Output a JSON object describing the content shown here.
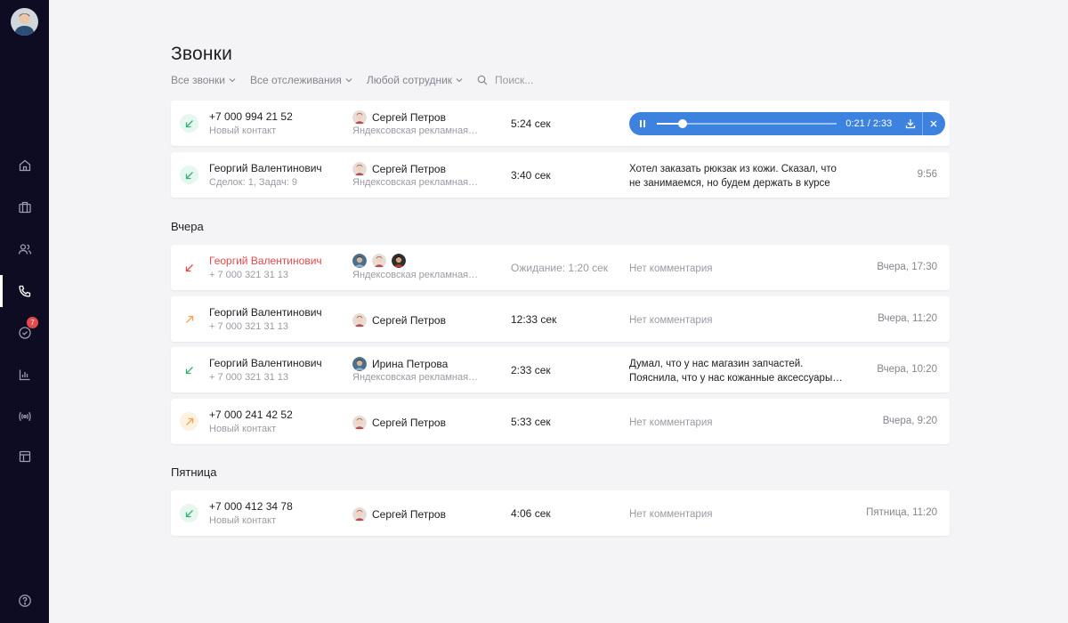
{
  "page": {
    "title": "Звонки"
  },
  "filters": {
    "calls": "Все звонки",
    "tracking": "Все отслеживания",
    "employee": "Любой сотрудник",
    "search_placeholder": "Поиск..."
  },
  "sections": {
    "yesterday": "Вчера",
    "friday": "Пятница"
  },
  "player": {
    "time": "0:21 / 2:33",
    "progress": 0.14
  },
  "colors": {
    "accent": "#3d82de",
    "missed": "#e5484d",
    "incoming": "#34b378",
    "outgoing": "#f0a54a",
    "sidebar": "#0d0c22"
  },
  "sidebar": {
    "badge_count": "7"
  },
  "rows": [
    {
      "name": "+7 000 994 21 52",
      "sub": "Новый контакт",
      "agent": "Сергей Петров",
      "source": "Яндексовская рекламная…",
      "duration": "5:24 сек",
      "direction": "in"
    },
    {
      "name": "Георгий Валентинович",
      "sub": "Сделок: 1, Задач: 9",
      "agent": "Сергей Петров",
      "source": "Яндексовская рекламная…",
      "duration": "3:40 сек",
      "comment_1": "Хотел заказать рюкзак из кожи. Сказал, что",
      "comment_2": "не занимаемся, но будем держать в курсе",
      "time": "9:56",
      "direction": "in"
    },
    {
      "name": "Георгий Валентинович",
      "sub": "+ 7 000 321 31 13",
      "source": "Яндексовская рекламная…",
      "duration": "Ожидание: 1:20 сек",
      "comment": "Нет комментария",
      "time": "Вчера, 17:30",
      "direction": "missed"
    },
    {
      "name": "Георгий Валентинович",
      "sub": "+ 7 000 321 31 13",
      "agent": "Сергей Петров",
      "duration": "12:33 сек",
      "comment": "Нет комментария",
      "time": "Вчера, 11:20",
      "direction": "out"
    },
    {
      "name": "Георгий Валентинович",
      "sub": "+ 7 000 321 31 13",
      "agent": "Ирина Петрова",
      "source": "Яндексовская рекламная…",
      "duration": "2:33 сек",
      "comment_1": "Думал, что у нас магазин запчастей.",
      "comment_2": "Пояснила, что у нас кожанные аксессуары…",
      "time": "Вчера, 10:20",
      "direction": "in"
    },
    {
      "name": "+7 000 241 42 52",
      "sub": "Новый контакт",
      "agent": "Сергей Петров",
      "duration": "5:33 сек",
      "comment": "Нет комментария",
      "time": "Вчера, 9:20",
      "direction": "out"
    },
    {
      "name": "+7 000 412 34 78",
      "sub": "Новый контакт",
      "agent": "Сергей Петров",
      "duration": "4:06 сек",
      "comment": "Нет комментария",
      "time": "Пятница, 11:20",
      "direction": "in"
    }
  ]
}
